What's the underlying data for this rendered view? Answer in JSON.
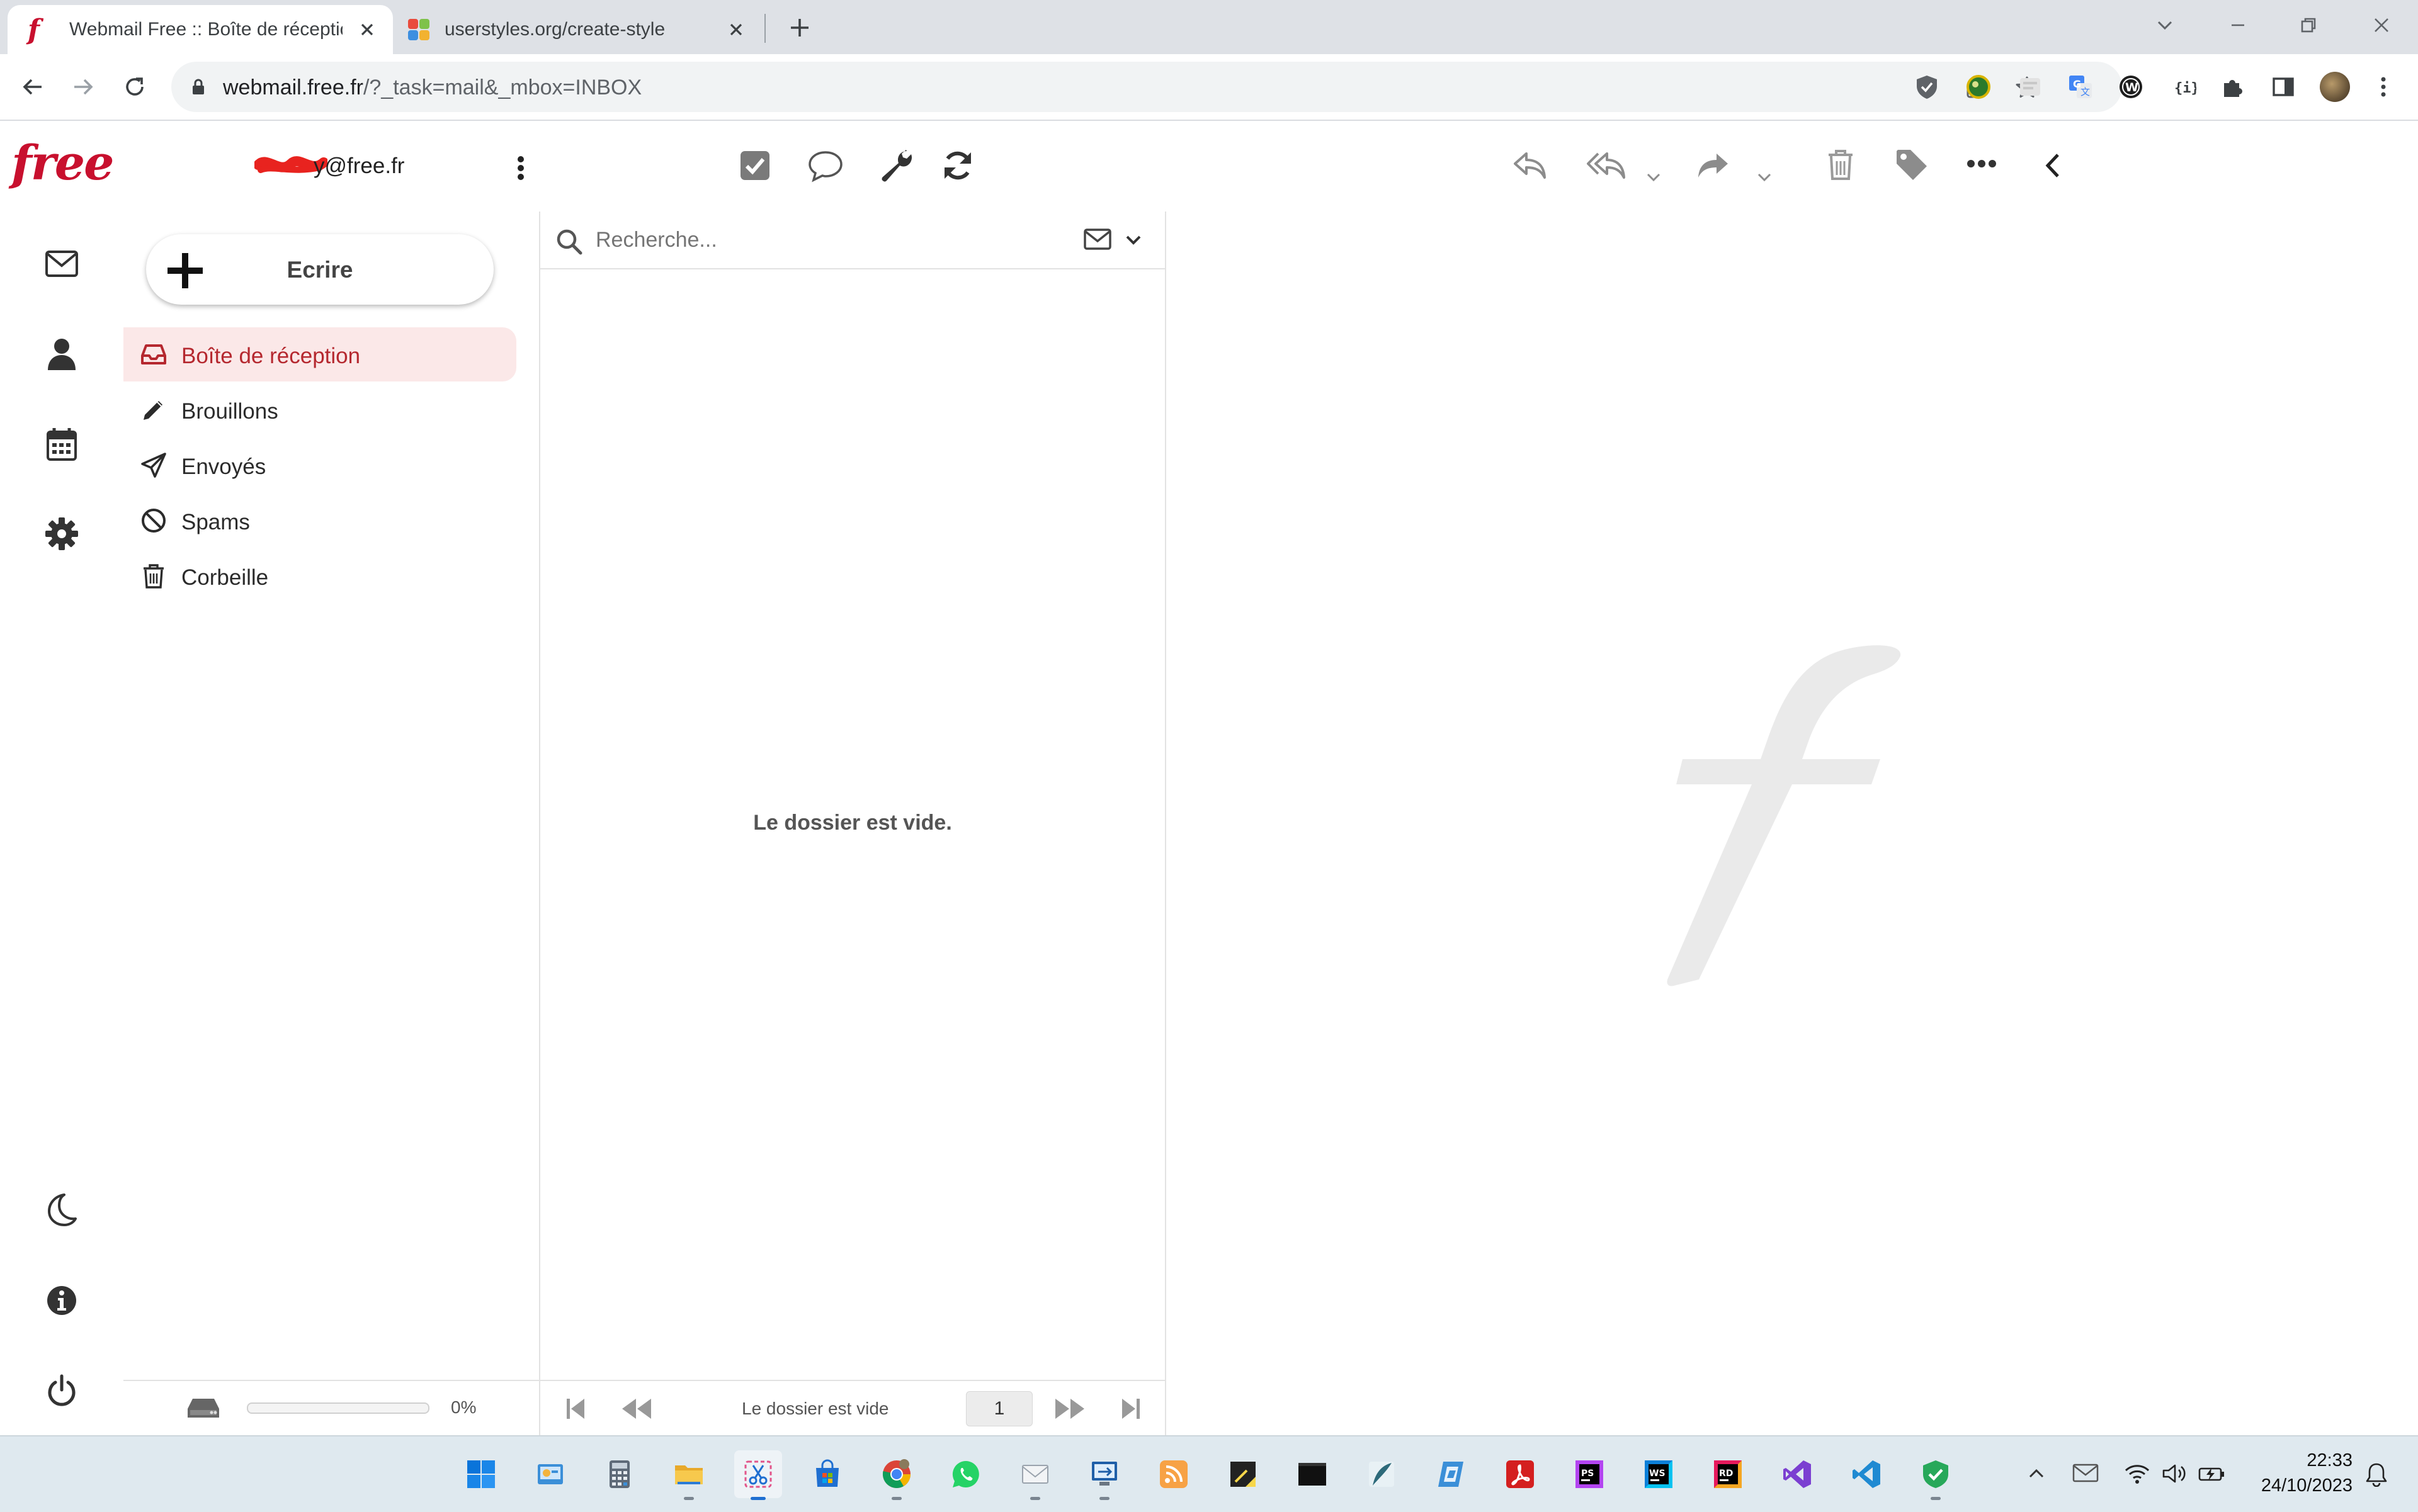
{
  "browser": {
    "tabs": [
      {
        "title": "Webmail Free :: Boîte de réception",
        "active": true
      },
      {
        "title": "userstyles.org/create-style",
        "active": false
      }
    ],
    "url_host": "webmail.free.fr",
    "url_path": "/?_task=mail&_mbox=INBOX"
  },
  "header": {
    "logo": "free",
    "account_email_suffix": "@free.fr",
    "account_email_prefix_hidden": "y",
    "toolbar_icons": [
      "select-checkbox-icon",
      "chat-bubble-icon",
      "wrench-icon",
      "refresh-icon"
    ],
    "message_actions": [
      "reply-icon",
      "reply-all-icon",
      "forward-icon",
      "trash-icon",
      "tag-icon",
      "more-icon",
      "collapse-left-icon"
    ]
  },
  "leftrail": {
    "top": [
      "mail-icon",
      "contacts-icon",
      "calendar-icon",
      "settings-icon"
    ],
    "bottom": [
      "dark-mode-icon",
      "info-icon",
      "logout-icon"
    ]
  },
  "compose": {
    "label": "Ecrire"
  },
  "folders": [
    {
      "label": "Boîte de réception",
      "icon": "inbox-icon",
      "selected": true
    },
    {
      "label": "Brouillons",
      "icon": "pencil-icon",
      "selected": false
    },
    {
      "label": "Envoyés",
      "icon": "sent-icon",
      "selected": false
    },
    {
      "label": "Spams",
      "icon": "spam-icon",
      "selected": false
    },
    {
      "label": "Corbeille",
      "icon": "trash-icon",
      "selected": false
    }
  ],
  "quota": {
    "percent_text": "0%",
    "fraction": 0
  },
  "search": {
    "placeholder": "Recherche..."
  },
  "message_list": {
    "empty_text": "Le dossier est vide.",
    "pager_text": "Le dossier est vide",
    "page": "1"
  },
  "taskbar": {
    "time": "22:33",
    "date": "24/10/2023"
  },
  "colors": {
    "brand_red": "#c8102e",
    "selected_bg": "#fbe8e8",
    "selected_text": "#b5282f"
  }
}
